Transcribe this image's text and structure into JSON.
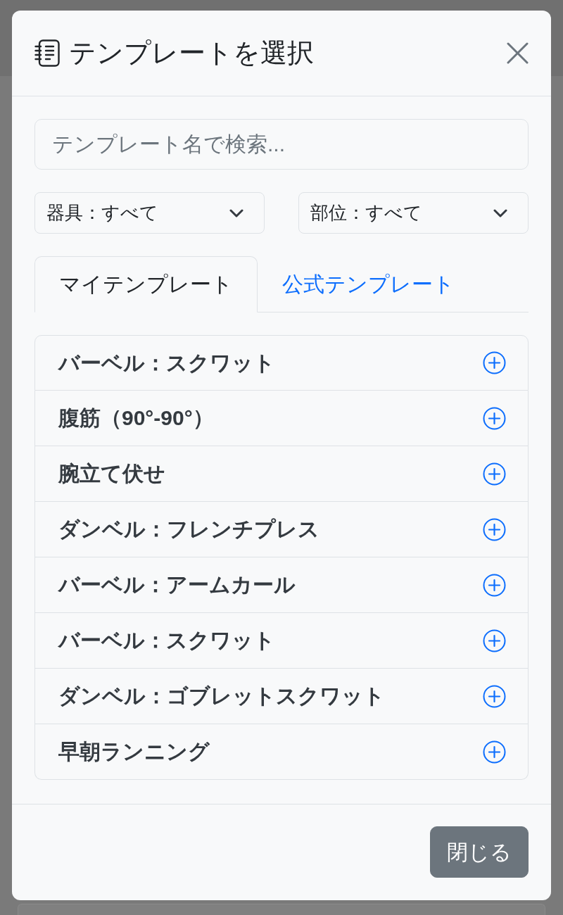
{
  "dialog": {
    "title": "テンプレートを選択"
  },
  "search": {
    "placeholder": "テンプレート名で検索..."
  },
  "filters": [
    {
      "label": "器具：すべて"
    },
    {
      "label": "部位：すべて"
    }
  ],
  "tabs": [
    {
      "label": "マイテンプレート",
      "selected": true
    },
    {
      "label": "公式テンプレート",
      "selected": false
    }
  ],
  "templates": [
    {
      "name": "バーベル：スクワット"
    },
    {
      "name": "腹筋（90°-90°）"
    },
    {
      "name": "腕立て伏せ"
    },
    {
      "name": "ダンベル：フレンチプレス"
    },
    {
      "name": "バーベル：アームカール"
    },
    {
      "name": "バーベル：スクワット"
    },
    {
      "name": "ダンベル：ゴブレットスクワット"
    },
    {
      "name": "早朝ランニング"
    }
  ],
  "footer": {
    "buttons": [
      {
        "label": "閉じる",
        "kind": "secondary"
      }
    ]
  }
}
